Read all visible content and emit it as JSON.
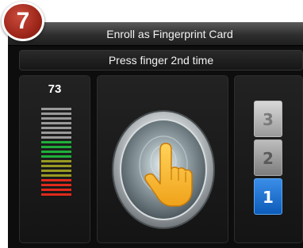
{
  "step_badge": "7",
  "title": "Enroll as Fingerprint Card",
  "prompt": "Press finger 2nd time",
  "quality": {
    "value": "73",
    "bar_colors": [
      "#9a9a9a",
      "#9a9a9a",
      "#9a9a9a",
      "#9a9a9a",
      "#9a9a9a",
      "#9a9a9a",
      "#9a9a9a",
      "#1fae3a",
      "#1fae3a",
      "#1fae3a",
      "#1fae3a",
      "#9a9a22",
      "#9a9a22",
      "#9a9a22",
      "#9a9a22",
      "#e02a1c",
      "#e02a1c",
      "#e02a1c",
      "#e02a1c"
    ]
  },
  "sensor": {
    "icon": "hand-pointer-icon"
  },
  "press_counter": {
    "labels": [
      "3",
      "2",
      "1"
    ],
    "active": "1"
  },
  "colors": {
    "active": "#1f78d8",
    "badge": "#a8281c"
  }
}
